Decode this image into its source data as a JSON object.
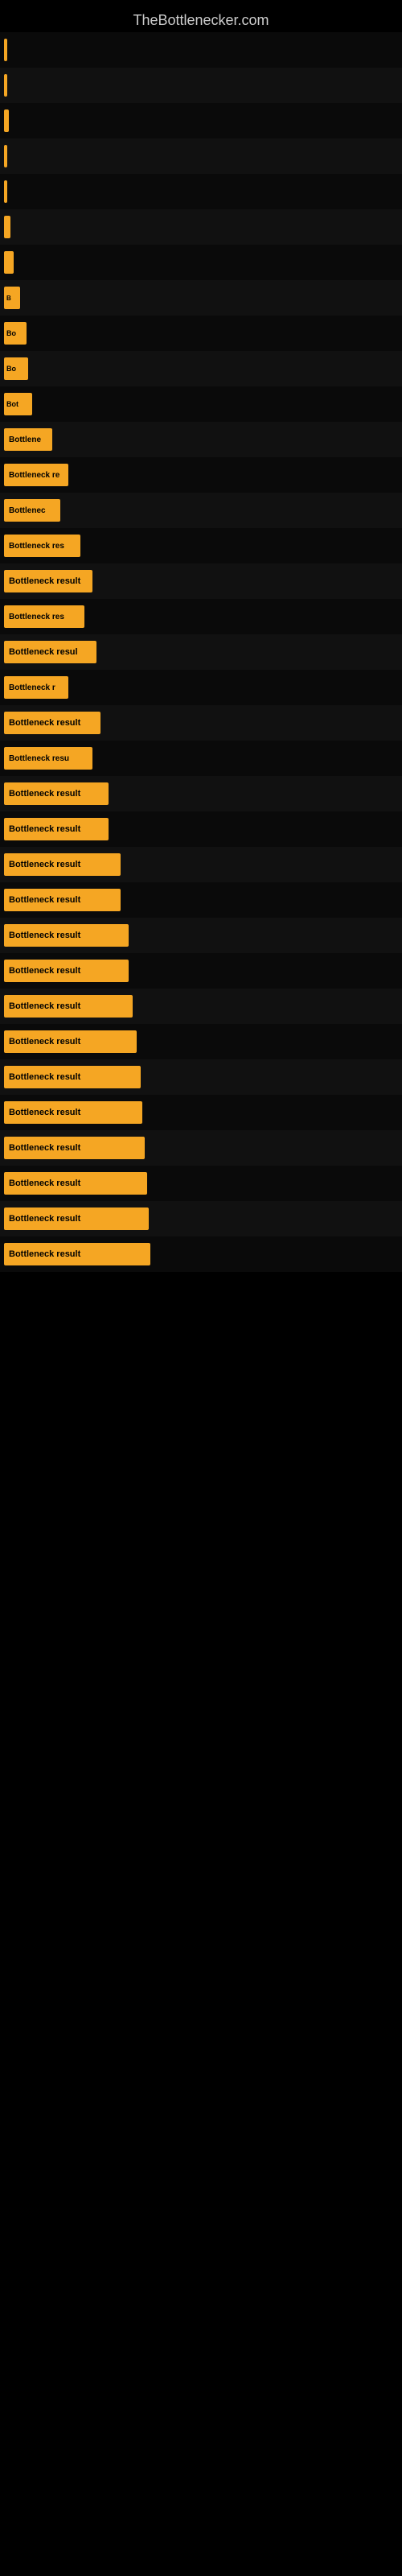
{
  "site": {
    "title": "TheBottlenecker.com"
  },
  "bars": [
    {
      "id": 1,
      "label": ""
    },
    {
      "id": 2,
      "label": ""
    },
    {
      "id": 3,
      "label": ""
    },
    {
      "id": 4,
      "label": ""
    },
    {
      "id": 5,
      "label": ""
    },
    {
      "id": 6,
      "label": ""
    },
    {
      "id": 7,
      "label": ""
    },
    {
      "id": 8,
      "label": "B"
    },
    {
      "id": 9,
      "label": "Bo"
    },
    {
      "id": 10,
      "label": "Bo"
    },
    {
      "id": 11,
      "label": "Bot"
    },
    {
      "id": 12,
      "label": "Bottlene"
    },
    {
      "id": 13,
      "label": "Bottleneck re"
    },
    {
      "id": 14,
      "label": "Bottlenec"
    },
    {
      "id": 15,
      "label": "Bottleneck res"
    },
    {
      "id": 16,
      "label": "Bottleneck result"
    },
    {
      "id": 17,
      "label": "Bottleneck res"
    },
    {
      "id": 18,
      "label": "Bottleneck resul"
    },
    {
      "id": 19,
      "label": "Bottleneck r"
    },
    {
      "id": 20,
      "label": "Bottleneck result"
    },
    {
      "id": 21,
      "label": "Bottleneck resu"
    },
    {
      "id": 22,
      "label": "Bottleneck result"
    },
    {
      "id": 23,
      "label": "Bottleneck result"
    },
    {
      "id": 24,
      "label": "Bottleneck result"
    },
    {
      "id": 25,
      "label": "Bottleneck result"
    },
    {
      "id": 26,
      "label": "Bottleneck result"
    },
    {
      "id": 27,
      "label": "Bottleneck result"
    },
    {
      "id": 28,
      "label": "Bottleneck result"
    },
    {
      "id": 29,
      "label": "Bottleneck result"
    },
    {
      "id": 30,
      "label": "Bottleneck result"
    },
    {
      "id": 31,
      "label": "Bottleneck result"
    },
    {
      "id": 32,
      "label": "Bottleneck result"
    },
    {
      "id": 33,
      "label": "Bottleneck result"
    },
    {
      "id": 34,
      "label": "Bottleneck result"
    },
    {
      "id": 35,
      "label": "Bottleneck result"
    }
  ]
}
